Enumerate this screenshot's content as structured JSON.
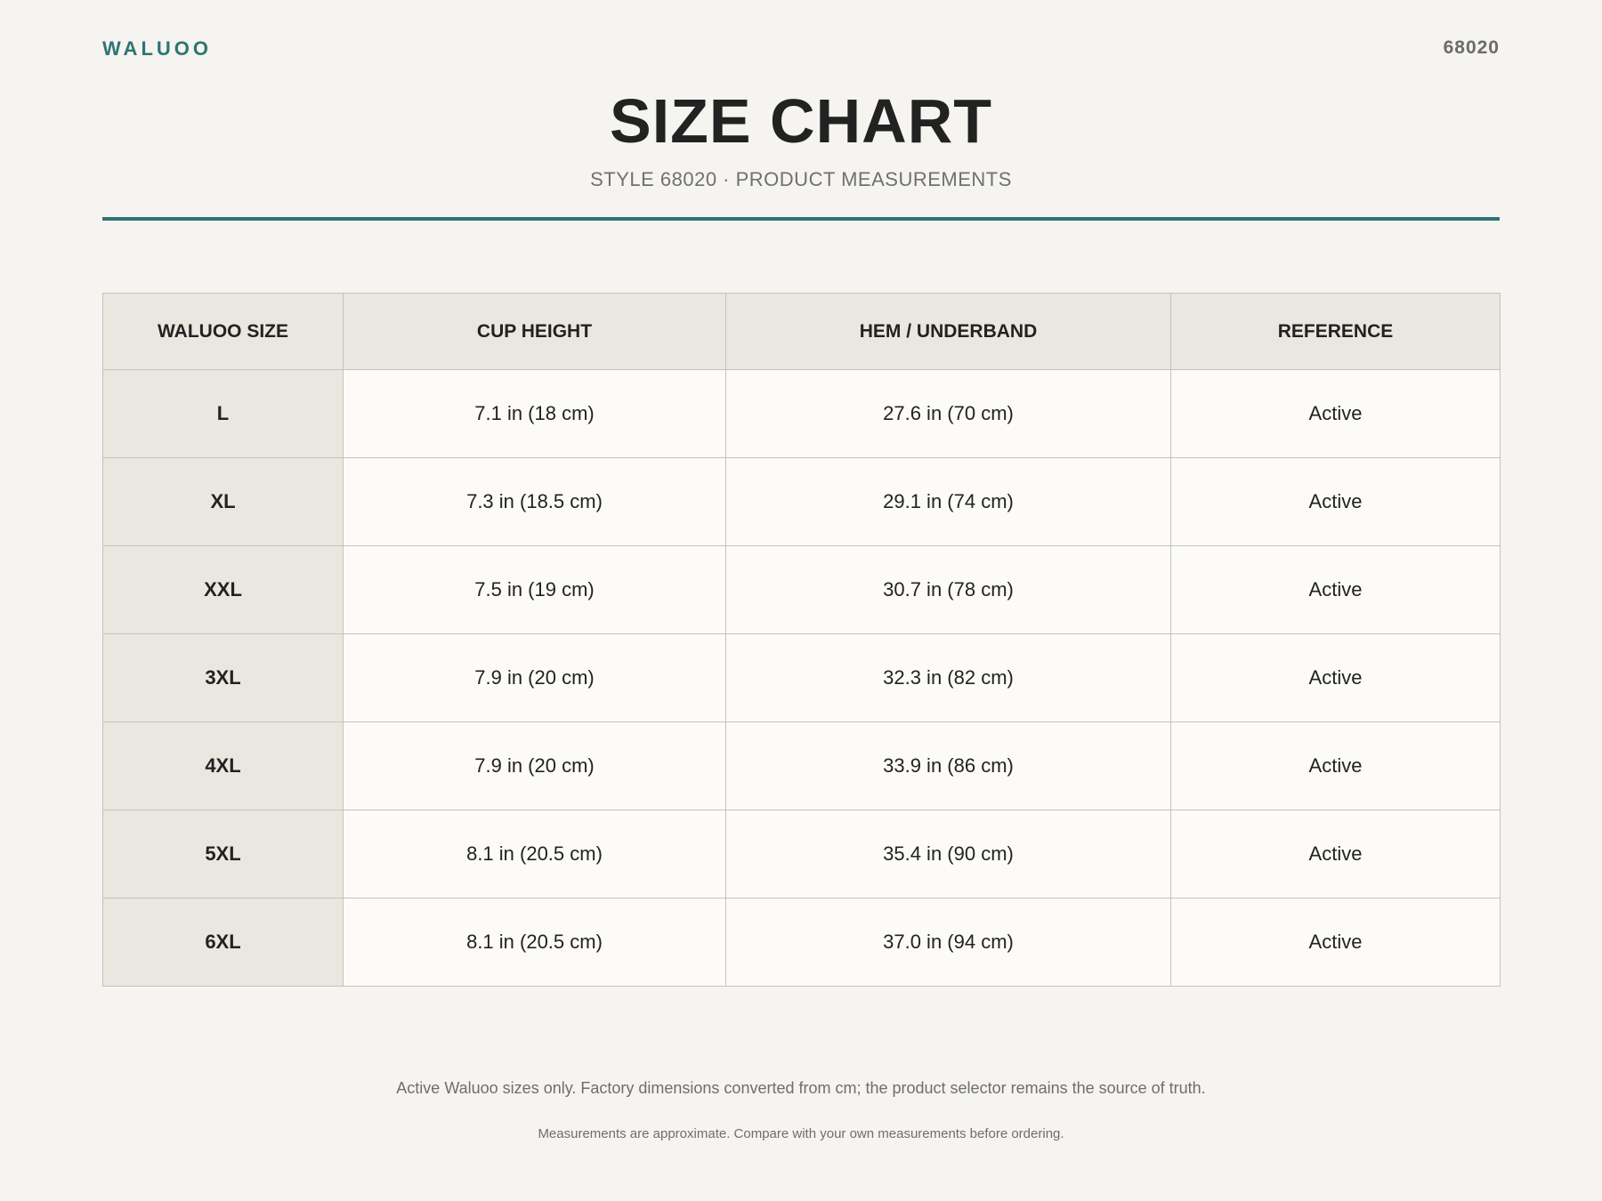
{
  "header": {
    "brand": "WALUOO",
    "style_code": "68020",
    "title": "SIZE CHART",
    "subtitle": "STYLE 68020 · PRODUCT MEASUREMENTS"
  },
  "colors": {
    "accent": "#2e7473",
    "header_bg": "#eae7e0",
    "cell_bg": "#fcfbf8",
    "page_bg": "#f5f4f0"
  },
  "table": {
    "columns": [
      "WALUOO SIZE",
      "CUP HEIGHT",
      "HEM / UNDERBAND",
      "REFERENCE"
    ],
    "rows": [
      [
        "L",
        "7.1 in (18 cm)",
        "27.6 in (70 cm)",
        "Active"
      ],
      [
        "XL",
        "7.3 in (18.5 cm)",
        "29.1 in (74 cm)",
        "Active"
      ],
      [
        "XXL",
        "7.5 in (19 cm)",
        "30.7 in (78 cm)",
        "Active"
      ],
      [
        "3XL",
        "7.9 in (20 cm)",
        "32.3 in (82 cm)",
        "Active"
      ],
      [
        "4XL",
        "7.9 in (20 cm)",
        "33.9 in (86 cm)",
        "Active"
      ],
      [
        "5XL",
        "8.1 in (20.5 cm)",
        "35.4 in (90 cm)",
        "Active"
      ],
      [
        "6XL",
        "8.1 in (20.5 cm)",
        "37.0 in (94 cm)",
        "Active"
      ]
    ]
  },
  "footer": {
    "note": "Active Waluoo sizes only. Factory dimensions converted from cm; the product selector remains the source of truth.",
    "disclaimer": "Measurements are approximate. Compare with your own measurements before ordering."
  }
}
